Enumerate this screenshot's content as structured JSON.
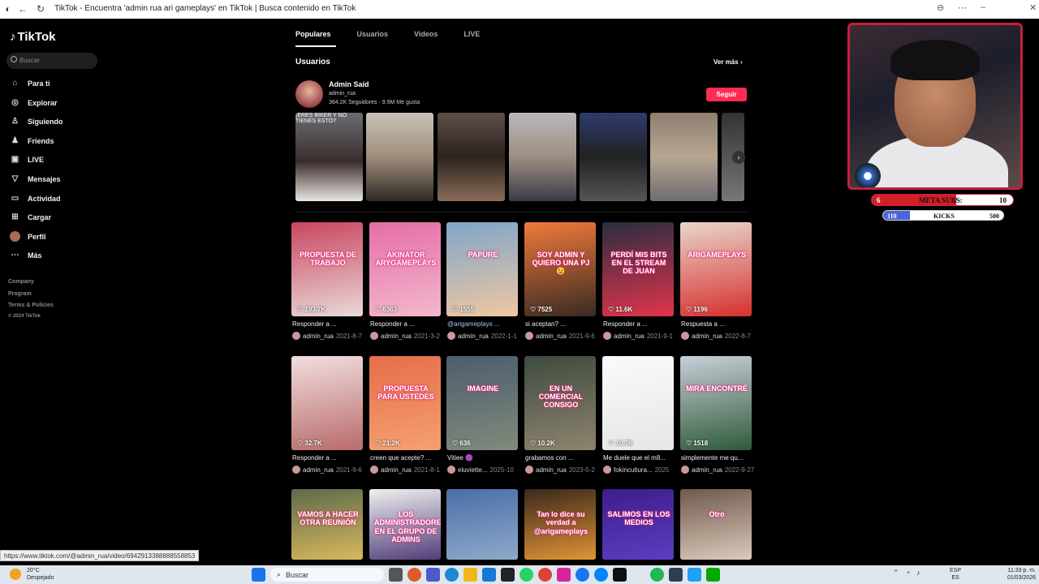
{
  "browser": {
    "title": "TikTok - Encuentra 'admin rua ari gameplays' en TikTok | Busca contenido en TikTok"
  },
  "sidebar": {
    "logo": "TikTok",
    "search_placeholder": "Buscar",
    "items": [
      {
        "label": "Para ti",
        "icon": "home-icon"
      },
      {
        "label": "Explorar",
        "icon": "compass-icon"
      },
      {
        "label": "Siguiendo",
        "icon": "following-icon"
      },
      {
        "label": "Friends",
        "icon": "friends-icon"
      },
      {
        "label": "LIVE",
        "icon": "live-icon"
      },
      {
        "label": "Mensajes",
        "icon": "messages-icon"
      },
      {
        "label": "Actividad",
        "icon": "activity-icon"
      },
      {
        "label": "Cargar",
        "icon": "upload-icon"
      },
      {
        "label": "Perfil",
        "icon": "profile-avatar"
      },
      {
        "label": "Más",
        "icon": "more-icon"
      }
    ],
    "footer": [
      "Company",
      "Program",
      "Terms & Policies",
      "© 2024 TikTok"
    ]
  },
  "tabs": [
    "Populares",
    "Usuarios",
    "Videos",
    "LIVE"
  ],
  "users_section": {
    "title": "Usuarios",
    "see_more": "Ver más"
  },
  "user": {
    "name": "Admin Said",
    "handle": "admin_rua",
    "followers": "364.2K Seguidores",
    "likes": "9.9M Me gusta",
    "follow_label": "Seguir"
  },
  "strip_captions": [
    "¡ERES BIKER Y NO TIENES ESTO?",
    "",
    "",
    "",
    "",
    "",
    ""
  ],
  "videos": [
    {
      "caption": "PROPUESTA DE TRABAJO",
      "likes": "193.7K",
      "desc": "Responder a ...",
      "user": "admin_rua",
      "date": "2021-8-7"
    },
    {
      "caption": "AKINATOR ARYGAMEPLAYS",
      "likes": "6363",
      "desc": "Responder a ...",
      "user": "admin_rua",
      "date": "2021-3-2"
    },
    {
      "caption": "PAPURE",
      "likes": "1555",
      "desc": "@arigameplays ...",
      "user": "admin_rua",
      "date": "2022-1-1"
    },
    {
      "caption": "SOY ADMIN Y QUIERO UNA PJ 😉",
      "likes": "7525",
      "desc": "si aceptan? ...",
      "user": "admin_rua",
      "date": "2021-9-6"
    },
    {
      "caption": "PERDÍ MIS BITS EN EL STREAM DE JUAN",
      "likes": "11.6K",
      "desc": "Responder a ...",
      "user": "admin_rua",
      "date": "2021-9-1"
    },
    {
      "caption": "ARIGAMEPLAYS",
      "likes": "1196",
      "desc": "Respuesta a ...",
      "user": "admin_rua",
      "date": "2022-8-7"
    },
    {
      "caption": "",
      "likes": "32.7K",
      "desc": "Responder a ...",
      "user": "admin_rua",
      "date": "2021-9-6"
    },
    {
      "caption": "PROPUESTA PARA USTEDES",
      "likes": "21.2K",
      "desc": "creen que acepte? ...",
      "user": "admin_rua",
      "date": "2021-8-1"
    },
    {
      "caption": "IMAGINE",
      "likes": "636",
      "desc": "Vitiee 🟣",
      "user": "eluviette...",
      "date": "2025-10"
    },
    {
      "caption": "EN UN COMERCIAL CONSIGO",
      "likes": "10.2K",
      "desc": "grabamos con ...",
      "user": "admin_rua",
      "date": "2023-5-2"
    },
    {
      "caption": "",
      "likes": "10.7K",
      "desc": "Me duele que el m8...",
      "user": "fokincultura...",
      "date": "2025"
    },
    {
      "caption": "MIRA ENCONTRÉ",
      "likes": "1518",
      "desc": "simplemente me qu...",
      "user": "admin_rua",
      "date": "2022-9-27"
    },
    {
      "caption": "VAMOS A HACER OTRA REUNIÓN",
      "likes": "",
      "desc": "",
      "user": "",
      "date": ""
    },
    {
      "caption": "LOS ADMINISTRADORES EN EL GRUPO DE ADMINS",
      "likes": "",
      "desc": "",
      "user": "",
      "date": ""
    },
    {
      "caption": "",
      "likes": "",
      "desc": "",
      "user": "",
      "date": ""
    },
    {
      "caption": "Tan lo dice su verdad a @arigameplays",
      "likes": "",
      "desc": "",
      "user": "",
      "date": ""
    },
    {
      "caption": "SALIMOS EN LOS MEDIOS",
      "likes": "",
      "desc": "",
      "user": "",
      "date": ""
    },
    {
      "caption": "Otro",
      "likes": "",
      "desc": "",
      "user": "",
      "date": ""
    }
  ],
  "stream_overlay": {
    "meta_label": "META SUBS:",
    "meta_current": "6",
    "meta_goal": "10",
    "meta_fraction": 0.6,
    "kicks_label": "KICKS",
    "kicks_current": "110",
    "kicks_goal": "500",
    "kicks_fraction": 0.22
  },
  "status_url": "https://www.tiktok.com/@admin_rua/video/6942913388888558853",
  "taskbar": {
    "temp": "20°C",
    "weather": "Despejado",
    "search": "Buscar",
    "lang1": "ESP",
    "lang2": "ES",
    "time": "11:33 p. m.",
    "date": "01/03/2026"
  }
}
